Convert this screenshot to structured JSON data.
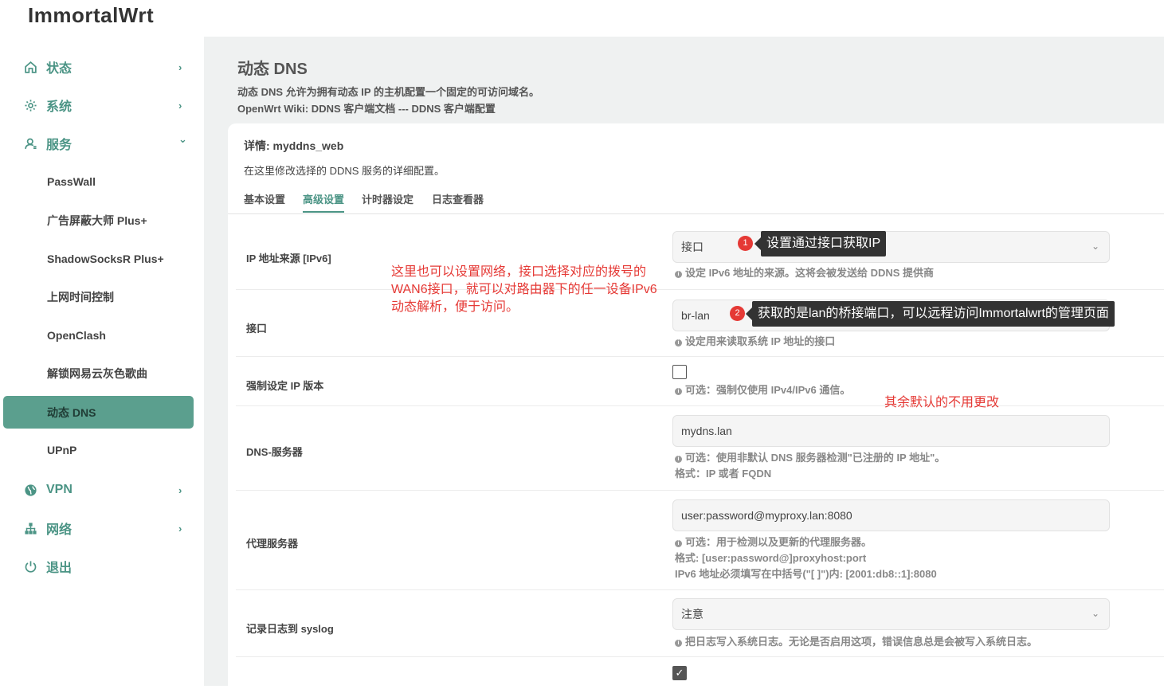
{
  "app": {
    "brand": "ImmortalWrt"
  },
  "sidebar": {
    "items": [
      {
        "label": "状态",
        "icon": "home-icon",
        "chevron": "›"
      },
      {
        "label": "系统",
        "icon": "gear-icon",
        "chevron": "›"
      },
      {
        "label": "服务",
        "icon": "user-icon",
        "chevron": "⌄"
      },
      {
        "label": "VPN",
        "icon": "globe-icon",
        "chevron": "›"
      },
      {
        "label": "网络",
        "icon": "network-icon",
        "chevron": "›"
      },
      {
        "label": "退出",
        "icon": "power-icon",
        "chevron": ""
      }
    ],
    "services": [
      "PassWall",
      "广告屏蔽大师 Plus+",
      "ShadowSocksR Plus+",
      "上网时间控制",
      "OpenClash",
      "解锁网易云灰色歌曲",
      "动态 DNS",
      "UPnP"
    ]
  },
  "page": {
    "title": "动态 DNS",
    "desc1": "动态 DNS 允许为拥有动态 IP 的主机配置一个固定的可访问域名。",
    "desc2": "OpenWrt Wiki: DDNS 客户端文档 --- DDNS 客户端配置"
  },
  "card": {
    "title": "详情: myddns_web",
    "desc": "在这里修改选择的 DDNS 服务的详细配置。",
    "tabs": [
      "基本设置",
      "高级设置",
      "计时器设定",
      "日志查看器"
    ]
  },
  "form": {
    "ip_source": {
      "label": "IP 地址来源 [IPv6]",
      "value": "接口",
      "hint": "设定 IPv6 地址的来源。这将会被发送给 DDNS 提供商"
    },
    "interface": {
      "label": "接口",
      "value": "br-lan",
      "hint": "设定用来读取系统 IP 地址的接口"
    },
    "force_ip": {
      "label": "强制设定 IP 版本",
      "hint": "可选：强制仅使用 IPv4/IPv6 通信。"
    },
    "dns_server": {
      "label": "DNS-服务器",
      "placeholder": "mydns.lan",
      "hint1": "可选：使用非默认 DNS 服务器检测\"已注册的 IP 地址\"。",
      "hint2": "格式：IP 或者 FQDN"
    },
    "proxy": {
      "label": "代理服务器",
      "placeholder": "user:password@myproxy.lan:8080",
      "hint1": "可选：用于检测以及更新的代理服务器。",
      "hint2": "格式: [user:password@]proxyhost:port",
      "hint3": "IPv6 地址必须填写在中括号(\"[ ]\")内: [2001:db8::1]:8080"
    },
    "syslog": {
      "label": "记录日志到 syslog",
      "value": "注意",
      "hint": "把日志写入系统日志。无论是否启用这项，错误信息总是会被写入系统日志。"
    }
  },
  "annotations": {
    "red_note_line1": "这里也可以设置网络，接口选择对应的拨号的",
    "red_note_line2": "WAN6接口，就可以对路由器下的任一设备IPv6",
    "red_note_line3": "动态解析，便于访问。",
    "red_note2": "其余默认的不用更改",
    "badge1": "1",
    "badge2": "2",
    "callout1": "设置通过接口获取IP",
    "callout2": "获取的是lan的桥接端口，可以远程访问Immortalwrt的管理页面"
  }
}
